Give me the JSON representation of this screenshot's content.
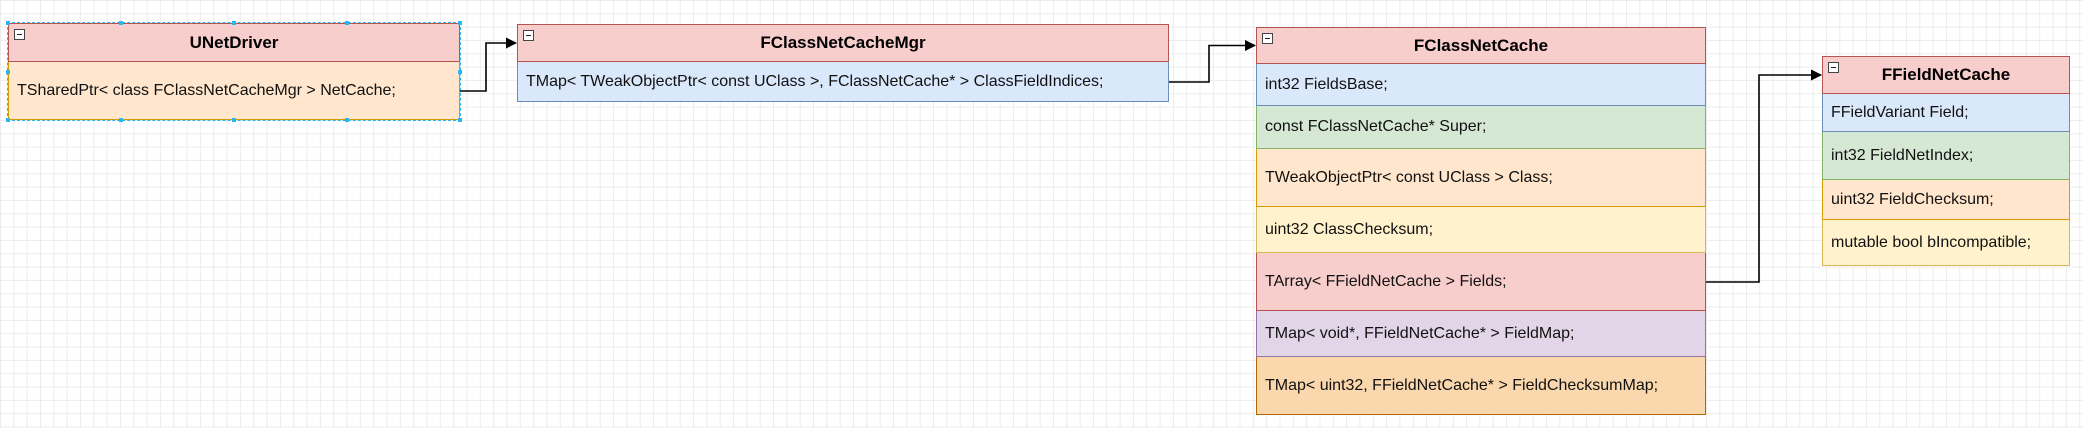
{
  "palette": {
    "header_fill": "#f8cecc",
    "header_border": "#b85450",
    "orange_fill": "#ffe6cc",
    "orange_border": "#d79b00",
    "blue_fill": "#dae8fc",
    "blue_border": "#6c8ebf",
    "green_fill": "#d5e8d4",
    "green_border": "#82b366",
    "yellow_fill": "#fff2cc",
    "yellow_border": "#d6b656",
    "red_fill": "#f8cecc",
    "red_border": "#b85450",
    "purple_fill": "#e1d5e7",
    "purple_border": "#9673a6",
    "deep_orange_fill": "#fad7ac",
    "deep_orange_border": "#b46504",
    "selection_color": "#29b6f2"
  },
  "icons": {
    "collapse": "minus-square-icon",
    "arrow": "filled-arrowhead"
  },
  "classes": {
    "unetdriver": {
      "title": "UNetDriver",
      "selected": true,
      "fields": [
        {
          "text": "TSharedPtr< class FClassNetCacheMgr > NetCache;",
          "color": "orange"
        }
      ]
    },
    "fclassnetcachemgr": {
      "title": "FClassNetCacheMgr",
      "selected": false,
      "fields": [
        {
          "text": "TMap< TWeakObjectPtr< const UClass >, FClassNetCache* > ClassFieldIndices;",
          "color": "blue"
        }
      ]
    },
    "fclassnetcache": {
      "title": "FClassNetCache",
      "selected": false,
      "fields": [
        {
          "text": "int32 FieldsBase;",
          "color": "blue"
        },
        {
          "text": "const FClassNetCache* Super;",
          "color": "green"
        },
        {
          "text": "TWeakObjectPtr< const UClass > Class;",
          "color": "orange"
        },
        {
          "text": "uint32 ClassChecksum;",
          "color": "yellow"
        },
        {
          "text": "TArray< FFieldNetCache > Fields;",
          "color": "red"
        },
        {
          "text": "TMap< void*, FFieldNetCache* > FieldMap;",
          "color": "purple"
        },
        {
          "text": "TMap< uint32, FFieldNetCache* > FieldChecksumMap;",
          "color": "deep_orange"
        }
      ]
    },
    "ffieldnetcache": {
      "title": "FFieldNetCache",
      "selected": false,
      "fields": [
        {
          "text": "FFieldVariant Field;",
          "color": "blue"
        },
        {
          "text": "int32 FieldNetIndex;",
          "color": "green"
        },
        {
          "text": "uint32 FieldChecksum;",
          "color": "orange"
        },
        {
          "text": "mutable bool bIncompatible;",
          "color": "yellow"
        }
      ]
    }
  },
  "connections": [
    {
      "from": "unetdriver.field0",
      "to": "fclassnetcachemgr.header"
    },
    {
      "from": "fclassnetcachemgr.field0",
      "to": "fclassnetcache.header"
    },
    {
      "from": "fclassnetcache.field4",
      "to": "ffieldnetcache.header"
    }
  ]
}
